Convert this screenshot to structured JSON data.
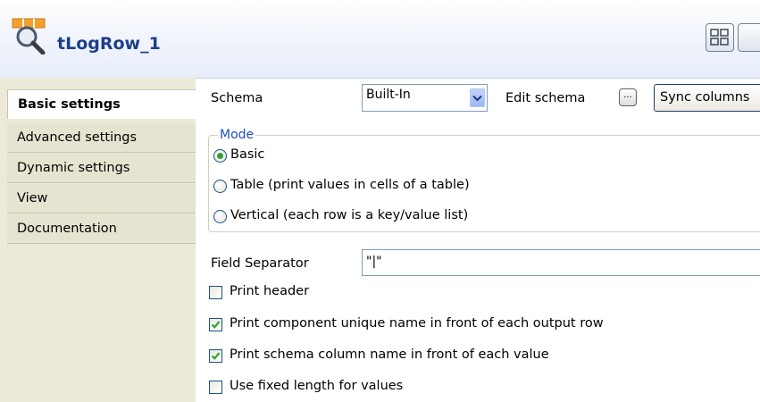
{
  "header": {
    "title": "tLogRow_1",
    "icon": "log-row-component-icon"
  },
  "tabs": [
    {
      "label": "Basic settings",
      "active": true
    },
    {
      "label": "Advanced settings",
      "active": false
    },
    {
      "label": "Dynamic settings",
      "active": false
    },
    {
      "label": "View",
      "active": false
    },
    {
      "label": "Documentation",
      "active": false
    }
  ],
  "schema": {
    "label": "Schema",
    "value": "Built-In",
    "edit_label": "Edit schema",
    "edit_button": "...",
    "sync_label": "Sync columns"
  },
  "mode": {
    "legend": "Mode",
    "options": [
      {
        "label": "Basic",
        "selected": true
      },
      {
        "label": "Table (print values in cells of a table)",
        "selected": false
      },
      {
        "label": "Vertical (each row is a key/value list)",
        "selected": false
      }
    ]
  },
  "field_separator": {
    "label": "Field Separator",
    "value": "\"|\""
  },
  "options": [
    {
      "label": "Print header",
      "checked": false
    },
    {
      "label": "Print component unique name in front of each output row",
      "checked": true
    },
    {
      "label": "Print schema column name in front of each value",
      "checked": true
    },
    {
      "label": "Use fixed length for values",
      "checked": false
    }
  ],
  "colors": {
    "title": "#1d3f8a",
    "legend": "#1f51b7",
    "sidebar": "#ece9d8",
    "check": "#2fa12f"
  }
}
